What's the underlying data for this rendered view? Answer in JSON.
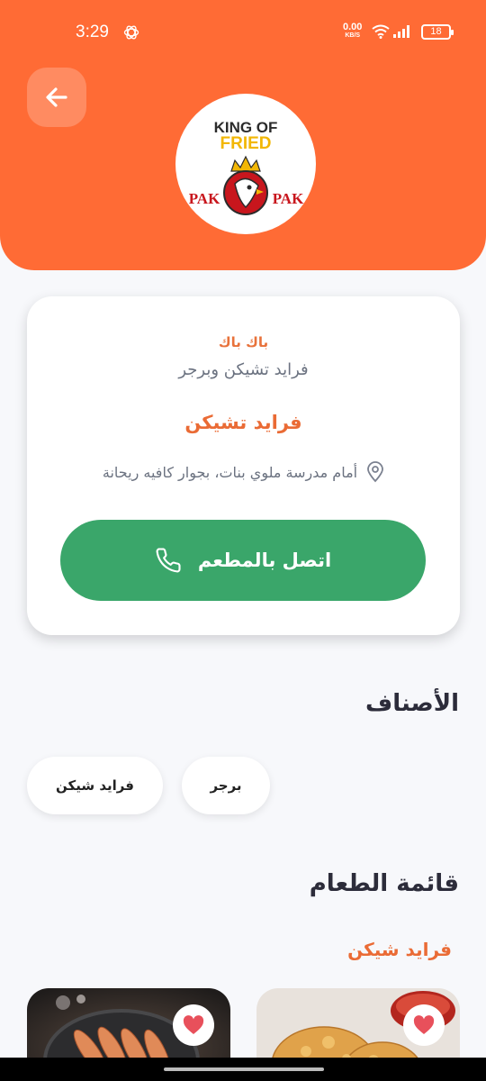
{
  "status_bar": {
    "time": "3:29",
    "net_speed": "0.00",
    "net_unit": "KB/S",
    "battery": "18"
  },
  "restaurant": {
    "logo_text_line1": "KING OF",
    "logo_text_line2": "FRIED",
    "logo_text_left": "PAK",
    "logo_text_right": "PAK",
    "name": "باك باك",
    "description": "فرايد تشيكن وبرجر",
    "type": "فرايد تشيكن",
    "address": "أمام مدرسة ملوي بنات، بجوار كافيه ريحانة",
    "call_label": "اتصل بالمطعم"
  },
  "categories": {
    "title": "الأصناف",
    "items": [
      "برجر",
      "فرايد شيكن"
    ]
  },
  "menu": {
    "title": "قائمة الطعام",
    "section_name": "فرايد شيكن"
  },
  "colors": {
    "accent": "#ff6b35",
    "call_button": "#3aa66a",
    "favorite": "#e8505b"
  },
  "icons": [
    "back-arrow-icon",
    "location-pin-icon",
    "phone-icon",
    "heart-icon"
  ]
}
